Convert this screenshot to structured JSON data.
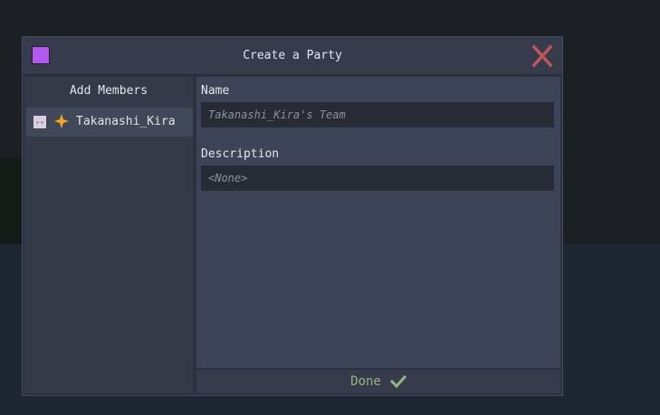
{
  "dialog": {
    "title": "Create a Party",
    "party_color": "#b259f0",
    "close_icon": "close-icon"
  },
  "members": {
    "header": "Add Members",
    "items": [
      {
        "name": "Takanashi_Kira",
        "avatar": "player-head-icon",
        "badge": "leader-star-icon"
      }
    ]
  },
  "form": {
    "name_label": "Name",
    "name_placeholder": "Takanashi_Kira's Team",
    "description_label": "Description",
    "description_placeholder": "<None>"
  },
  "footer": {
    "done_label": "Done",
    "done_icon": "checkmark-icon"
  },
  "colors": {
    "accent_close": "#c0555e",
    "leader_star": "#f2a71c",
    "done_text": "#93b57f"
  }
}
